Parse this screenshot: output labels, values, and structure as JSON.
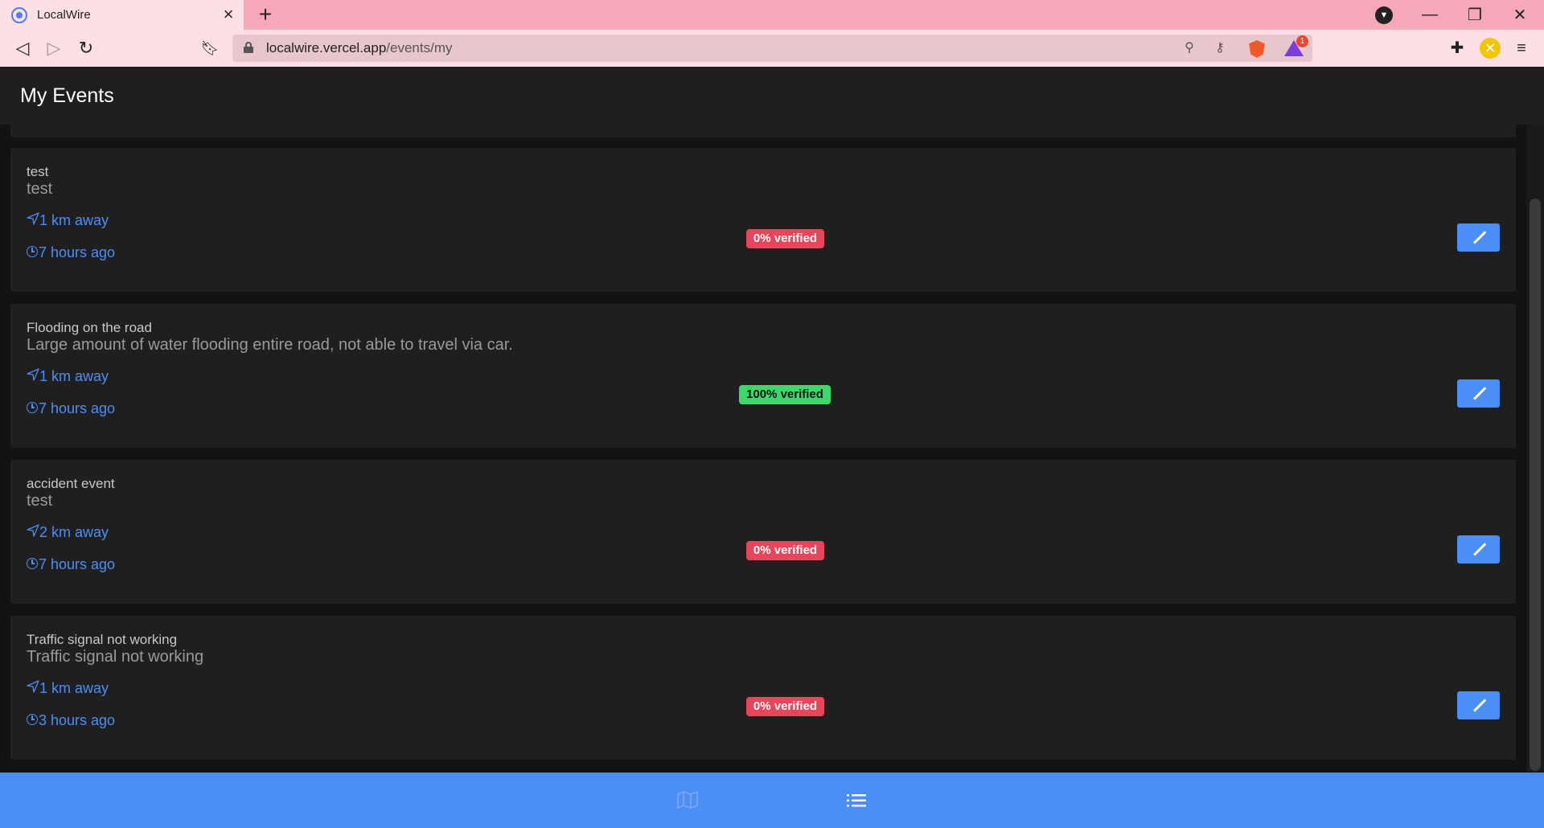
{
  "browser": {
    "tab_title": "LocalWire",
    "url_host": "localwire.vercel.app",
    "url_path": "/events/my",
    "rewards_badge": "1"
  },
  "app": {
    "title": "My Events"
  },
  "events": [
    {
      "title": "test",
      "description": "test",
      "distance": "1 km away",
      "time": "7 hours ago",
      "verified": "0% verified",
      "status": "red"
    },
    {
      "title": "Flooding on the road",
      "description": "Large amount of water flooding entire road, not able to travel via car.",
      "distance": "1 km away",
      "time": "7 hours ago",
      "verified": "100% verified",
      "status": "green"
    },
    {
      "title": "accident event",
      "description": "test",
      "distance": "2 km away",
      "time": "7 hours ago",
      "verified": "0% verified",
      "status": "red"
    },
    {
      "title": "Traffic signal not working",
      "description": "Traffic signal not working",
      "distance": "1 km away",
      "time": "3 hours ago",
      "verified": "0% verified",
      "status": "red"
    }
  ],
  "colors": {
    "accent": "#4b8ef6",
    "badge_red": "#e8445a",
    "badge_green": "#3dd86a",
    "card_bg": "#1f1f1f",
    "page_bg": "#121212"
  },
  "bottom_nav": {
    "items": [
      {
        "icon": "map-icon",
        "active": false
      },
      {
        "icon": "list-icon",
        "active": true
      }
    ]
  }
}
